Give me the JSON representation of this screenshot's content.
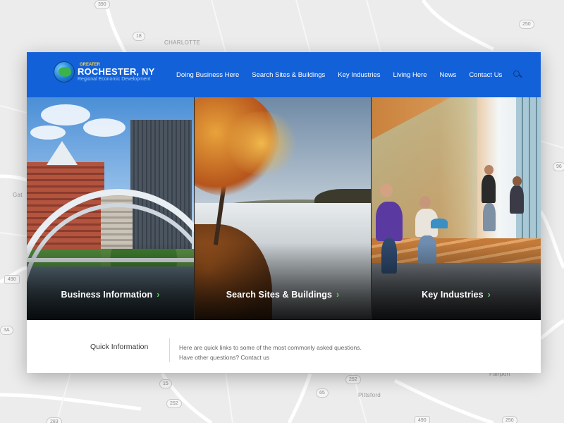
{
  "map": {
    "labels": [
      "CHARLOTTE",
      "Gat",
      "Pittsford",
      "Fairport"
    ],
    "shields": [
      "390",
      "18",
      "250",
      "490",
      "15",
      "252",
      "65",
      "252",
      "490",
      "283",
      "250",
      "3A",
      "96"
    ]
  },
  "site": {
    "logo": {
      "greater": "GREATER",
      "city": "ROCHESTER, NY",
      "subtitle": "Regional Economic Development"
    },
    "nav": [
      "Doing Business Here",
      "Search Sites & Buildings",
      "Key Industries",
      "Living Here",
      "News",
      "Contact Us"
    ],
    "panels": [
      {
        "label": "Business Information",
        "chevron": "›"
      },
      {
        "label": "Search Sites & Buildings",
        "chevron": "›"
      },
      {
        "label": "Key Industries",
        "chevron": "›"
      }
    ],
    "quick": {
      "title": "Quick Information",
      "line1": "Here are quick links to some of the most commonly asked questions.",
      "line2_prefix": "Have other questions? ",
      "line2_link": "Contact us"
    }
  },
  "colors": {
    "header": "#1361d8",
    "accent_chevron": "#5bd05a",
    "logo_greater": "#ffd24a"
  },
  "icons": [
    "search-icon",
    "chevron-right-icon",
    "globe-logo-icon"
  ]
}
